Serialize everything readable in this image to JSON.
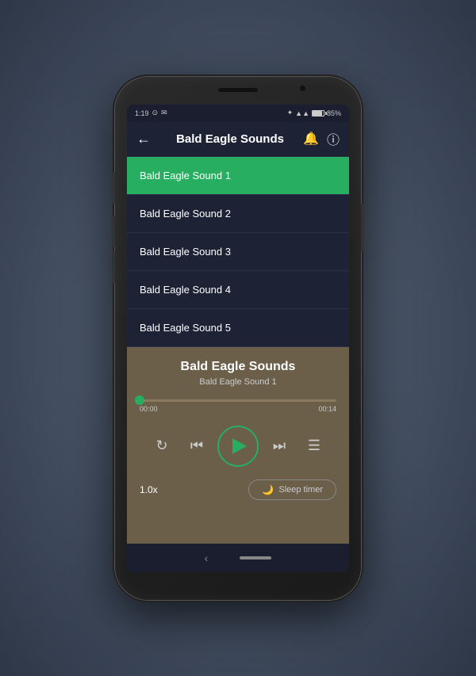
{
  "statusBar": {
    "time": "1:19",
    "batteryPercent": "85%"
  },
  "appBar": {
    "title": "Bald Eagle Sounds",
    "backLabel": "←",
    "bellLabel": "🔔",
    "infoLabel": "ⓘ"
  },
  "soundList": {
    "items": [
      {
        "id": 1,
        "label": "Bald Eagle Sound 1",
        "active": true
      },
      {
        "id": 2,
        "label": "Bald Eagle Sound 2",
        "active": false
      },
      {
        "id": 3,
        "label": "Bald Eagle Sound 3",
        "active": false
      },
      {
        "id": 4,
        "label": "Bald Eagle Sound 4",
        "active": false
      },
      {
        "id": 5,
        "label": "Bald Eagle Sound 5",
        "active": false
      }
    ]
  },
  "player": {
    "title": "Bald Eagle Sounds",
    "subtitle": "Bald Eagle Sound 1",
    "currentTime": "00:00",
    "totalTime": "00:14",
    "speed": "1.0x",
    "sleepTimerLabel": "Sleep timer"
  },
  "navBar": {
    "backLabel": "‹",
    "homeLabel": ""
  },
  "colors": {
    "activeGreen": "#27ae60",
    "appBarBg": "#1e2235",
    "listBg": "#1e2235",
    "playerBg": "#6b5f4a"
  }
}
